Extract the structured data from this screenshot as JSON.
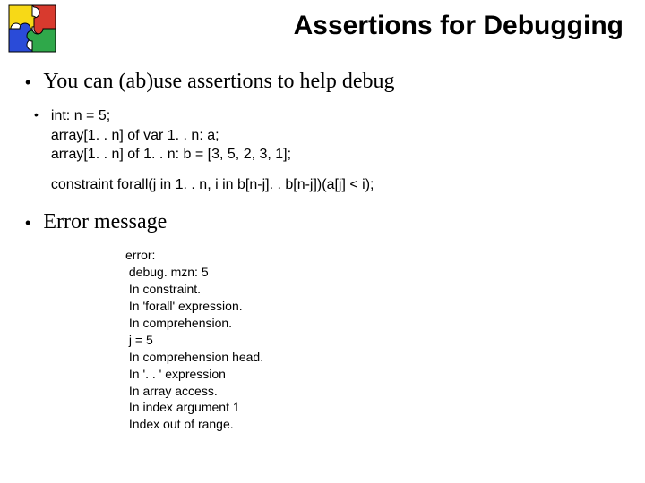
{
  "title": "Assertions for Debugging",
  "bullets": {
    "b1": "You can (ab)use assertions to help debug",
    "b2_code": {
      "l1": "int: n = 5;",
      "l2": "array[1. . n] of var 1. . n: a;",
      "l3": "array[1. . n] of 1. . n: b = [3, 5, 2, 3, 1];",
      "l4": "constraint forall(j in 1. . n, i in b[n-j]. . b[n-j])(a[j] < i);"
    },
    "b3": "Error message"
  },
  "error": {
    "e1": "error:",
    "e2": " debug. mzn: 5",
    "e3": " In constraint.",
    "e4": " In 'forall' expression.",
    "e5": " In comprehension.",
    "e6": " j = 5",
    "e7": " In comprehension head.",
    "e8": " In '. . ' expression",
    "e9": " In array access.",
    "e10": " In index argument 1",
    "e11": " Index out of range."
  },
  "logo": {
    "colors": {
      "yellow": "#f7d917",
      "red": "#d83a2e",
      "blue": "#2a4bd8",
      "green": "#2fa84a",
      "border": "#000000"
    }
  }
}
